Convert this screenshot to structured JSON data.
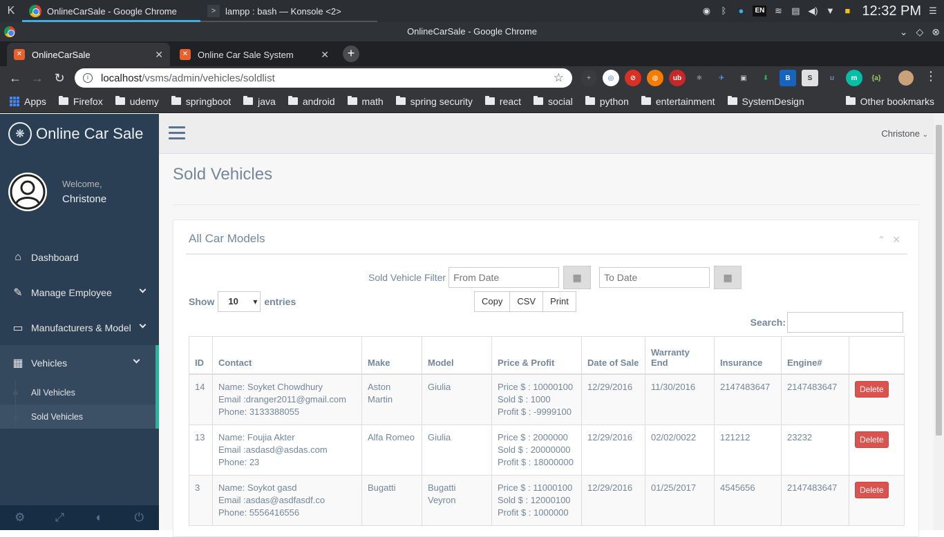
{
  "panel_os": {
    "tasks": [
      {
        "title": "OnlineCarSale - Google Chrome"
      },
      {
        "title": "lampp : bash — Konsole <2>"
      }
    ],
    "clock": "12:32 PM",
    "lang": "EN"
  },
  "browser": {
    "window_title": "OnlineCarSale - Google Chrome",
    "tabs": [
      {
        "label": "OnlineCarSale"
      },
      {
        "label": "Online Car Sale System"
      }
    ],
    "url_host": "localhost",
    "url_path": "/vsms/admin/vehicles/soldlist",
    "bookmarks": [
      "Apps",
      "Firefox",
      "udemy",
      "springboot",
      "java",
      "android",
      "math",
      "spring security",
      "react",
      "social",
      "python",
      "entertainment",
      "SystemDesign"
    ],
    "other_bookmarks": "Other bookmarks"
  },
  "sidebar": {
    "brand": "Online Car Sale",
    "welcome": "Welcome,",
    "username": "Christone",
    "items": [
      {
        "label": "Dashboard"
      },
      {
        "label": "Manage Employee"
      },
      {
        "label": "Manufacturers & Model"
      },
      {
        "label": "Vehicles"
      }
    ],
    "sub_items": [
      {
        "label": "All Vehicles"
      },
      {
        "label": "Sold Vehicles"
      }
    ]
  },
  "topbar": {
    "user": "Christone"
  },
  "page": {
    "title": "Sold Vehicles",
    "panel_title": "All Car Models",
    "filter_label": "Sold Vehicle Filter",
    "from_placeholder": "From Date",
    "to_placeholder": "To Date",
    "show_label": "Show",
    "entries_value": "10",
    "entries_label": "entries",
    "buttons": [
      "Copy",
      "CSV",
      "Print"
    ],
    "search_label": "Search:"
  },
  "table": {
    "headers": [
      "ID",
      "Contact",
      "Make",
      "Model",
      "Price & Profit",
      "Date of Sale",
      "Warranty End",
      "Insurance",
      "Engine#",
      ""
    ],
    "delete_label": "Delete",
    "rows": [
      {
        "id": "14",
        "contact": [
          "Name: Soyket Chowdhury",
          "Email :dranger2011@gmail.com",
          "Phone: 3133388055"
        ],
        "make": "Aston Martin",
        "model": "Giulia",
        "price": [
          "Price $ : 10000100",
          "Sold $ : 1000",
          "Profit $ : -9999100"
        ],
        "date_of_sale": "12/29/2016",
        "warranty_end": "11/30/2016",
        "insurance": "2147483647",
        "engine": "2147483647"
      },
      {
        "id": "13",
        "contact": [
          "Name: Foujia Akter",
          "Email :asdasd@asdas.com",
          "Phone: 23"
        ],
        "make": "Alfa Romeo",
        "model": "Giulia",
        "price": [
          "Price $ : 2000000",
          "Sold $ : 20000000",
          "Profit $ : 18000000"
        ],
        "date_of_sale": "12/29/2016",
        "warranty_end": "02/02/0022",
        "insurance": "121212",
        "engine": "23232"
      },
      {
        "id": "3",
        "contact": [
          "Name: Soykot gasd",
          "Email :asdas@asdfasdf.co",
          "Phone: 5556416556"
        ],
        "make": "Bugatti",
        "model": "Bugatti Veyron",
        "price": [
          "Price $ : 11000100",
          "Sold $ : 12000100",
          "Profit $ : 1000000"
        ],
        "date_of_sale": "12/29/2016",
        "warranty_end": "01/25/2017",
        "insurance": "4545656",
        "engine": "2147483647"
      }
    ]
  }
}
